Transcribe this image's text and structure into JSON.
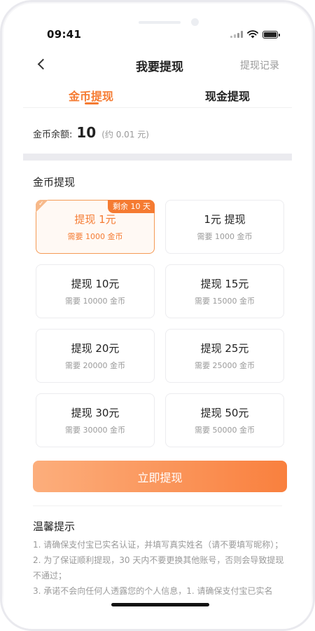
{
  "status_bar": {
    "time": "09:41"
  },
  "nav": {
    "title": "我要提现",
    "right_link": "提现记录",
    "back_icon": "chevron-left-icon"
  },
  "tabs": [
    {
      "label": "金币提现",
      "active": true
    },
    {
      "label": "现金提现",
      "active": false
    }
  ],
  "balance": {
    "label": "金币余额:",
    "value": "10",
    "approx": "(约 0.01 元)"
  },
  "section_title": "金币提现",
  "options": [
    {
      "title": "提现 1元",
      "sub": "需要 1000 金币",
      "badge": "剩余 10 天",
      "selected": true
    },
    {
      "title": "1元 提现",
      "sub": "需要 1000 金币",
      "selected": false
    },
    {
      "title": "提现 10元",
      "sub": "需要 10000 金币",
      "selected": false
    },
    {
      "title": "提现 15元",
      "sub": "需要 15000 金币",
      "selected": false
    },
    {
      "title": "提现 20元",
      "sub": "需要 20000 金币",
      "selected": false
    },
    {
      "title": "提现 25元",
      "sub": "需要 25000 金币",
      "selected": false
    },
    {
      "title": "提现 30元",
      "sub": "需要 30000 金币",
      "selected": false
    },
    {
      "title": "提现 50元",
      "sub": "需要 50000 金币",
      "selected": false
    }
  ],
  "submit_label": "立即提现",
  "tips": {
    "title": "温馨提示",
    "items": [
      "1. 请确保支付宝已实名认证，并填写真实姓名（请不要填写昵称）；",
      "2. 为了保证顺利提现，30 天内不要更换其他账号，否则会导致提现不通过；",
      "3. 承诺不会向任何人透露您的个人信息，1. 请确保支付宝已实名"
    ]
  },
  "colors": {
    "accent": "#f57b32",
    "button_start": "#fcae7c",
    "button_end": "#f9803e"
  }
}
